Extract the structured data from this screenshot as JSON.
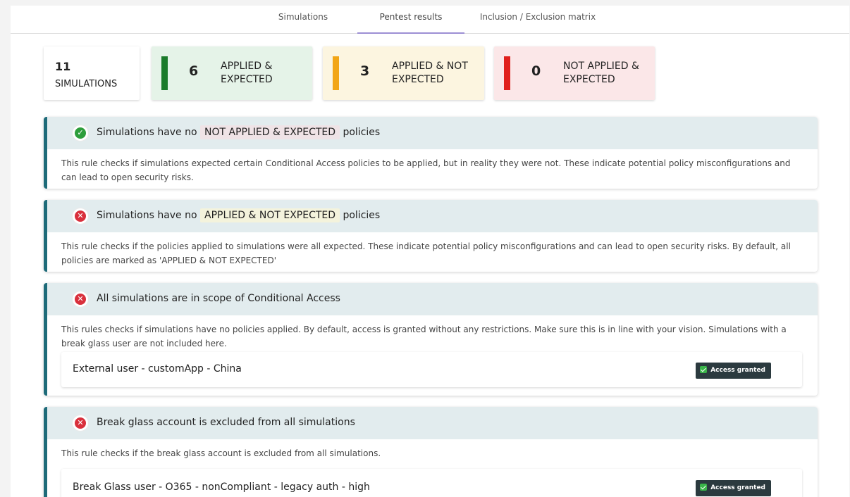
{
  "tabs": [
    {
      "label": "Simulations",
      "active": false
    },
    {
      "label": "Pentest results",
      "active": true
    },
    {
      "label": "Inclusion / Exclusion matrix",
      "active": false
    }
  ],
  "summary": {
    "total": {
      "count": "11",
      "label": "SIMULATIONS"
    },
    "cards": [
      {
        "count": "6",
        "label": "APPLIED & EXPECTED",
        "bar_color": "#1b7a2b",
        "bg_color": "#e5f3e8"
      },
      {
        "count": "3",
        "label": "APPLIED & NOT EXPECTED",
        "bar_color": "#f2a516",
        "bg_color": "#fcf5e0"
      },
      {
        "count": "0",
        "label": "NOT APPLIED & EXPECTED",
        "bar_color": "#e0201c",
        "bg_color": "#fbe7e8"
      }
    ]
  },
  "rules": [
    {
      "status": "pass",
      "icon": "check-circle-icon",
      "title_pre": "Simulations have no",
      "title_highlight": "NOT APPLIED & EXPECTED",
      "title_post": "policies",
      "description": "This rule checks if simulations expected certain Conditional Access policies to be applied, but in reality they were not. These indicate potential policy misconfigurations and can lead to open security risks."
    },
    {
      "status": "fail",
      "icon": "x-circle-icon",
      "title_pre": "Simulations have no",
      "title_highlight": "APPLIED & NOT EXPECTED",
      "title_post": "policies",
      "description": "This rule checks if the policies applied to simulations were all expected. These indicate potential policy misconfigurations and can lead to open security risks. By default, all policies are marked as 'APPLIED & NOT EXPECTED'"
    },
    {
      "status": "fail",
      "icon": "x-circle-icon",
      "title": "All simulations are in scope of Conditional Access",
      "description": "This rules checks if simulations have no policies applied. By default, access is granted without any restrictions. Make sure this is in line with your vision. Simulations with a break glass user are not included here.",
      "items": [
        {
          "label": "External user - customApp - China",
          "badge": "Access granted"
        }
      ]
    },
    {
      "status": "fail",
      "icon": "x-circle-icon",
      "title": "Break glass account is excluded from all simulations",
      "description": "This rule checks if the break glass account is excluded from all simulations.",
      "items": [
        {
          "label": "Break Glass user - O365 - nonCompliant - legacy auth - high",
          "badge": "Access granted"
        }
      ]
    }
  ],
  "colors": {
    "pass": "#2e9e3c",
    "fail": "#d9303c",
    "accent": "#1e6b79",
    "highlight_not_applied": "#efe3e6",
    "highlight_applied_not_expected": "#f4f3dc"
  }
}
